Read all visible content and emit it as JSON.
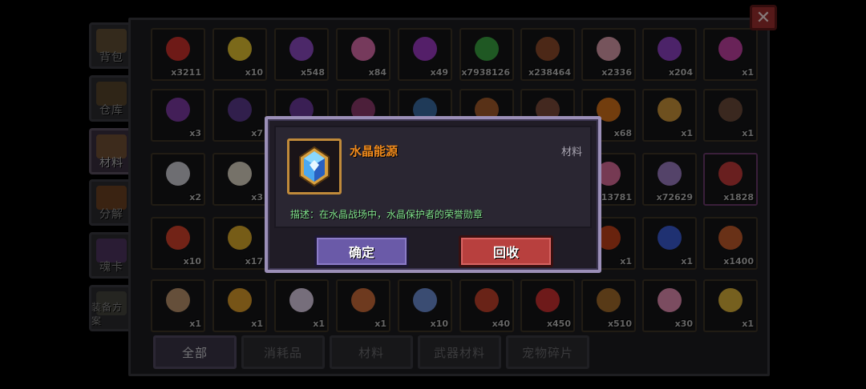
{
  "sidebar": [
    {
      "label": "背包",
      "icon": "chest-icon",
      "color": "#8a6a3a",
      "active": false
    },
    {
      "label": "仓库",
      "icon": "warehouse-icon",
      "color": "#7a5a2a",
      "active": false
    },
    {
      "label": "材料",
      "icon": "materials-icon",
      "color": "#9a6a2a",
      "active": true
    },
    {
      "label": "分解",
      "icon": "anvil-icon",
      "color": "#a0541a",
      "active": false
    },
    {
      "label": "魂卡",
      "icon": "soul-card-icon",
      "color": "#6a3a8a",
      "active": false
    },
    {
      "label": "装备方案",
      "icon": "equipment-icon",
      "color": "#5a5a4a",
      "active": false
    }
  ],
  "grid": [
    [
      {
        "name": "heart",
        "count": "x3211",
        "color": "#c8302a"
      },
      {
        "name": "smiley",
        "count": "x10",
        "color": "#e0c030"
      },
      {
        "name": "purple-cat",
        "count": "x548",
        "color": "#8a4ac0"
      },
      {
        "name": "pink-paw",
        "count": "x84",
        "color": "#d86aa8"
      },
      {
        "name": "paw-orb",
        "count": "x49",
        "color": "#9a3ac0"
      },
      {
        "name": "green-slime",
        "count": "x7938126",
        "color": "#3aa040"
      },
      {
        "name": "brown-pelt",
        "count": "x238464",
        "color": "#8a4a2a"
      },
      {
        "name": "pink-pelt",
        "count": "x2336",
        "color": "#d89aa8"
      },
      {
        "name": "puzzle-piece",
        "count": "x204",
        "color": "#8a40c0"
      },
      {
        "name": "laser-blade",
        "count": "x1",
        "color": "#c040a0"
      }
    ],
    [
      {
        "name": "demon-mask",
        "count": "x3",
        "color": "#7a3aa0"
      },
      {
        "name": "dark-crystal",
        "count": "x7",
        "color": "#5a3a8a"
      },
      {
        "name": "item-13",
        "count": "",
        "color": "#6a3a9a"
      },
      {
        "name": "item-14",
        "count": "",
        "color": "#8a3a6a"
      },
      {
        "name": "item-15",
        "count": "",
        "color": "#3a6aa0"
      },
      {
        "name": "item-16",
        "count": "",
        "color": "#a05a2a"
      },
      {
        "name": "item-17",
        "count": "",
        "color": "#7a4a3a"
      },
      {
        "name": "pumpkin",
        "count": "x68",
        "color": "#d0701a"
      },
      {
        "name": "bread",
        "count": "x1",
        "color": "#c8923a"
      },
      {
        "name": "dirt-pile",
        "count": "x1",
        "color": "#6a4a3a"
      }
    ],
    [
      {
        "name": "rice-bowl",
        "count": "x2",
        "color": "#c8c8d0"
      },
      {
        "name": "salt-jar",
        "count": "x3",
        "color": "#d8d0c0"
      },
      {
        "name": "item-23",
        "count": "",
        "color": "#555"
      },
      {
        "name": "item-24",
        "count": "",
        "color": "#555"
      },
      {
        "name": "item-25",
        "count": "",
        "color": "#555"
      },
      {
        "name": "item-26",
        "count": "",
        "color": "#555"
      },
      {
        "name": "item-27",
        "count": "",
        "color": "#555"
      },
      {
        "name": "pink-flower",
        "count": "x13781",
        "color": "#d86a98"
      },
      {
        "name": "purple-box",
        "count": "x72629",
        "color": "#9a7ac0"
      },
      {
        "name": "red-pin",
        "count": "x1828",
        "color": "#c03a3a"
      }
    ],
    [
      {
        "name": "red-lotus",
        "count": "x10",
        "color": "#d0402a"
      },
      {
        "name": "gold-cross",
        "count": "x17",
        "color": "#d8a82a"
      },
      {
        "name": "item-33",
        "count": "",
        "color": "#555"
      },
      {
        "name": "item-34",
        "count": "",
        "color": "#555"
      },
      {
        "name": "item-35",
        "count": "",
        "color": "#555"
      },
      {
        "name": "item-36",
        "count": "",
        "color": "#555"
      },
      {
        "name": "item-37",
        "count": "",
        "color": "#555"
      },
      {
        "name": "red-leaf",
        "count": "x1",
        "color": "#c0401a"
      },
      {
        "name": "blue-rose",
        "count": "x1",
        "color": "#3a5ad0"
      },
      {
        "name": "roast-chicken",
        "count": "x1400",
        "color": "#c05a2a"
      }
    ],
    [
      {
        "name": "scroll",
        "count": "x1",
        "color": "#b8906a"
      },
      {
        "name": "fireworks",
        "count": "x1",
        "color": "#d89a2a"
      },
      {
        "name": "pearl",
        "count": "x1",
        "color": "#d8c8e0"
      },
      {
        "name": "food-bowl",
        "count": "x1",
        "color": "#c86a3a"
      },
      {
        "name": "music-note",
        "count": "x10",
        "color": "#6a8ad0"
      },
      {
        "name": "clown-box",
        "count": "x40",
        "color": "#c0402a"
      },
      {
        "name": "crab-badge",
        "count": "x450",
        "color": "#c83030"
      },
      {
        "name": "broom",
        "count": "x510",
        "color": "#a06a2a"
      },
      {
        "name": "love-letter",
        "count": "x30",
        "color": "#e08ab0"
      },
      {
        "name": "gold-pile",
        "count": "x1",
        "color": "#d8b03a"
      }
    ]
  ],
  "bottom_tabs": [
    {
      "label": "全部",
      "active": true
    },
    {
      "label": "消耗品",
      "active": false
    },
    {
      "label": "材料",
      "active": false
    },
    {
      "label": "武器材料",
      "active": false
    },
    {
      "label": "宠物碎片",
      "active": false
    }
  ],
  "dialog": {
    "item_name": "水晶能源",
    "item_type": "材料",
    "description": "描述：在水晶战场中，水晶保护者的荣誉勋章",
    "icon": "crystal-icon",
    "confirm_label": "确定",
    "recycle_label": "回收"
  },
  "close_label": "✕"
}
